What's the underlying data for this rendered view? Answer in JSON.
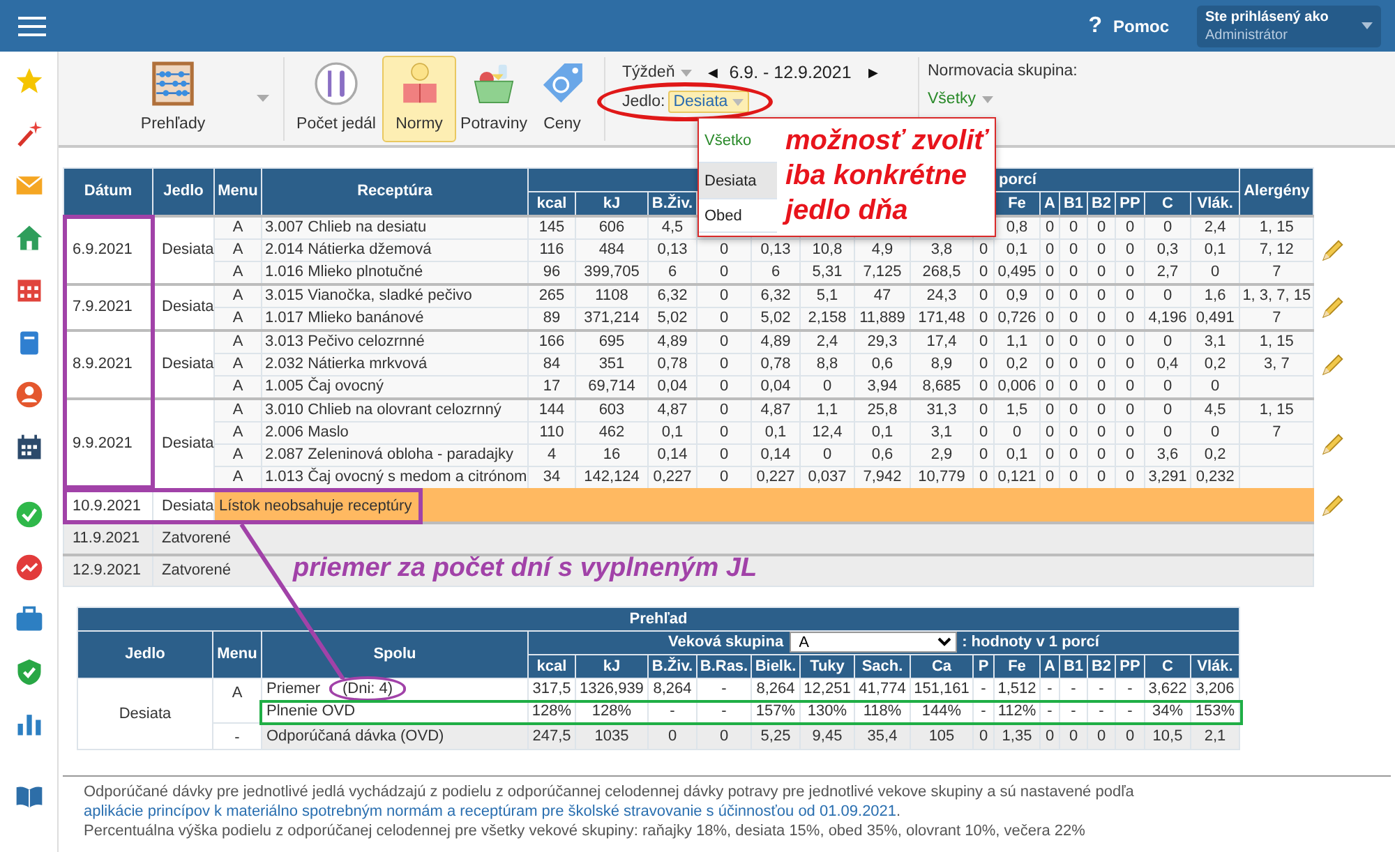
{
  "header": {
    "help_icon": "?",
    "help": "Pomoc",
    "user_label": "Ste prihlásený ako",
    "user_name": "Administrátor"
  },
  "toolbar": {
    "items": [
      {
        "label": "Prehľady",
        "selected": false,
        "dropdown": true
      },
      {
        "label": "Počet jedál",
        "selected": false,
        "dropdown": false
      },
      {
        "label": "Normy",
        "selected": true,
        "dropdown": false
      },
      {
        "label": "Potraviny",
        "selected": false,
        "dropdown": false
      },
      {
        "label": "Ceny",
        "selected": false,
        "dropdown": false
      }
    ]
  },
  "period": {
    "mode": "Týždeň",
    "prev": "◀",
    "range": "6.9. - 12.9.2021",
    "next": "▶"
  },
  "meal_filter": {
    "label": "Jedlo:",
    "value": "Desiata",
    "options": [
      {
        "label": "Všetko",
        "kind": "all",
        "selected": false
      },
      {
        "label": "Desiata",
        "kind": "meal",
        "selected": true
      },
      {
        "label": "Obed",
        "kind": "meal",
        "selected": false
      }
    ]
  },
  "norm_group": {
    "label": "Normovacia skupina:",
    "value": "Všetky"
  },
  "main_table": {
    "columns": [
      "Dátum",
      "Jedlo",
      "Menu",
      "Receptúra"
    ],
    "group_header": "porcí",
    "allergens_header": "Alergény",
    "nutrient_columns": [
      "kcal",
      "kJ",
      "B.Živ."
    ],
    "nutrient_columns_after_popup": [
      "Fe",
      "A",
      "B1",
      "B2",
      "PP",
      "C",
      "Vlák."
    ],
    "days": [
      {
        "kind": "menu",
        "date": "6.9.2021",
        "meal": "Desiata",
        "editable": true,
        "rows": [
          {
            "menu": "A",
            "recipe": "3.007 Chlieb na desiatu",
            "values": [
              "145",
              "606",
              "4,5"
            ],
            "values_after_popup": [
              "0,8",
              "0",
              "0",
              "0",
              "0",
              "0",
              "2,4"
            ],
            "allergens": "1, 15"
          },
          {
            "menu": "A",
            "recipe": "2.014 Nátierka džemová",
            "values": [
              "116",
              "484",
              "0,13",
              "0",
              "0,13",
              "10,8",
              "4,9",
              "3,8",
              "0",
              "0,1",
              "0",
              "0",
              "0",
              "0",
              "0,3",
              "0,1"
            ],
            "allergens": "7, 12"
          },
          {
            "menu": "A",
            "recipe": "1.016 Mlieko plnotučné",
            "values": [
              "96",
              "399,705",
              "6",
              "0",
              "6",
              "5,31",
              "7,125",
              "268,5",
              "0",
              "0,495",
              "0",
              "0",
              "0",
              "0",
              "2,7",
              "0"
            ],
            "allergens": "7"
          }
        ]
      },
      {
        "kind": "menu",
        "date": "7.9.2021",
        "meal": "Desiata",
        "editable": true,
        "rows": [
          {
            "menu": "A",
            "recipe": "3.015 Vianočka, sladké pečivo",
            "values": [
              "265",
              "1108",
              "6,32",
              "0",
              "6,32",
              "5,1",
              "47",
              "24,3",
              "0",
              "0,9",
              "0",
              "0",
              "0",
              "0",
              "0",
              "1,6"
            ],
            "allergens": "1, 3, 7, 15"
          },
          {
            "menu": "A",
            "recipe": "1.017 Mlieko banánové",
            "values": [
              "89",
              "371,214",
              "5,02",
              "0",
              "5,02",
              "2,158",
              "11,889",
              "171,48",
              "0",
              "0,726",
              "0",
              "0",
              "0",
              "0",
              "4,196",
              "0,491"
            ],
            "allergens": "7"
          }
        ]
      },
      {
        "kind": "menu",
        "date": "8.9.2021",
        "meal": "Desiata",
        "editable": true,
        "rows": [
          {
            "menu": "A",
            "recipe": "3.013 Pečivo celozrnné",
            "values": [
              "166",
              "695",
              "4,89",
              "0",
              "4,89",
              "2,4",
              "29,3",
              "17,4",
              "0",
              "1,1",
              "0",
              "0",
              "0",
              "0",
              "0",
              "3,1"
            ],
            "allergens": "1, 15"
          },
          {
            "menu": "A",
            "recipe": "2.032 Nátierka mrkvová",
            "values": [
              "84",
              "351",
              "0,78",
              "0",
              "0,78",
              "8,8",
              "0,6",
              "8,9",
              "0",
              "0,2",
              "0",
              "0",
              "0",
              "0",
              "0,4",
              "0,2"
            ],
            "allergens": "3, 7"
          },
          {
            "menu": "A",
            "recipe": "1.005 Čaj ovocný",
            "values": [
              "17",
              "69,714",
              "0,04",
              "0",
              "0,04",
              "0",
              "3,94",
              "8,685",
              "0",
              "0,006",
              "0",
              "0",
              "0",
              "0",
              "0",
              "0"
            ]
          }
        ]
      },
      {
        "kind": "menu",
        "date": "9.9.2021",
        "meal": "Desiata",
        "editable": true,
        "rows": [
          {
            "menu": "A",
            "recipe": "3.010 Chlieb na olovrant celozrnný",
            "values": [
              "144",
              "603",
              "4,87",
              "0",
              "4,87",
              "1,1",
              "25,8",
              "31,3",
              "0",
              "1,5",
              "0",
              "0",
              "0",
              "0",
              "0",
              "4,5"
            ],
            "allergens": "1, 15"
          },
          {
            "menu": "A",
            "recipe": "2.006 Maslo",
            "values": [
              "110",
              "462",
              "0,1",
              "0",
              "0,1",
              "12,4",
              "0,1",
              "3,1",
              "0",
              "0",
              "0",
              "0",
              "0",
              "0",
              "0",
              "0"
            ],
            "allergens": "7"
          },
          {
            "menu": "A",
            "recipe": "2.087 Zeleninová obloha - paradajky",
            "values": [
              "4",
              "16",
              "0,14",
              "0",
              "0,14",
              "0",
              "0,6",
              "2,9",
              "0",
              "0,1",
              "0",
              "0",
              "0",
              "0",
              "3,6",
              "0,2"
            ]
          },
          {
            "menu": "A",
            "recipe": "1.013 Čaj ovocný s medom a citrónom",
            "values": [
              "34",
              "142,124",
              "0,227",
              "0",
              "0,227",
              "0,037",
              "7,942",
              "10,779",
              "0",
              "0,121",
              "0",
              "0",
              "0",
              "0",
              "3,291",
              "0,232"
            ]
          }
        ]
      },
      {
        "kind": "no_recipes",
        "date": "10.9.2021",
        "meal": "Desiata",
        "note": "Lístok neobsahuje receptúry",
        "editable": true
      },
      {
        "kind": "closed",
        "date": "11.9.2021",
        "note": "Zatvorené",
        "editable": false
      },
      {
        "kind": "closed",
        "date": "12.9.2021",
        "note": "Zatvorené",
        "editable": false
      }
    ]
  },
  "summary": {
    "title": "Prehľad",
    "columns": [
      "Jedlo",
      "Menu",
      "Spolu"
    ],
    "age_label": "Veková skupina",
    "age_value": "A",
    "age_suffix": ": hodnoty v 1 porcí",
    "nutrient_columns": [
      "kcal",
      "kJ",
      "B.Živ.",
      "B.Ras.",
      "Bielk.",
      "Tuky",
      "Sach.",
      "Ca",
      "P",
      "Fe",
      "A",
      "B1",
      "B2",
      "PP",
      "C",
      "Vlák."
    ],
    "meal": "Desiata",
    "rows": [
      {
        "kind": "average",
        "menu": "A",
        "label": "Priemer",
        "extra": "(Dni: 4)",
        "values": [
          "317,5",
          "1326,939",
          "8,264",
          "-",
          "8,264",
          "12,251",
          "41,774",
          "151,161",
          "-",
          "1,512",
          "-",
          "-",
          "-",
          "-",
          "3,622",
          "3,206"
        ]
      },
      {
        "kind": "fulfilment",
        "label": "Plnenie OVD",
        "values": [
          "128%",
          "128%",
          "-",
          "-",
          "157%",
          "130%",
          "118%",
          "144%",
          "-",
          "112%",
          "-",
          "-",
          "-",
          "-",
          "34%",
          "153%"
        ]
      },
      {
        "kind": "recommended",
        "menu": "-",
        "label": "Odporúčaná dávka (OVD)",
        "values": [
          "247,5",
          "1035",
          "0",
          "0",
          "5,25",
          "9,45",
          "35,4",
          "105",
          "0",
          "1,35",
          "0",
          "0",
          "0",
          "0",
          "10,5",
          "2,1"
        ]
      }
    ]
  },
  "footer": [
    {
      "text": "Odporúčané dávky pre jednotlivé jedlá vychádzajú z podielu z odporúčannej celodennej dávky potravy pre jednotlivé vekove skupiny a sú nastavené podľa ",
      "link": "aplikácie princípov k materiálno spotrebným normám a receptúram pre školské stravovanie s účinnosťou od 01.09.2021",
      "text_after": "."
    },
    {
      "text": "Percentuálna výška podielu z odporúčanej celodennej pre všetky vekové skupiny: raňajky 18%, desiata 15%, obed 35%, olovrant 10%, večera 22%"
    }
  ],
  "annotations": {
    "dropdown_note": "možnosť zvoliť iba konkrétne jedlo dňa",
    "days_note": "priemer za počet dní s vyplneným JL"
  }
}
